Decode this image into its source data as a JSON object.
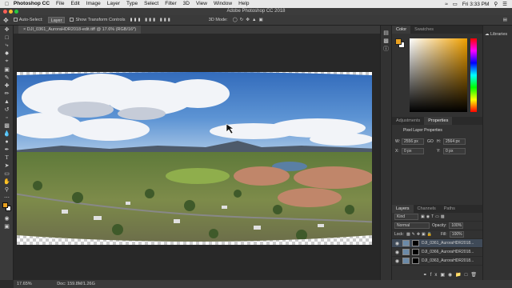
{
  "menubar": {
    "items": [
      "Photoshop CC",
      "File",
      "Edit",
      "Image",
      "Layer",
      "Type",
      "Select",
      "Filter",
      "3D",
      "View",
      "Window",
      "Help"
    ],
    "clock": "Fri 3:33 PM"
  },
  "window": {
    "title": "Adobe Photoshop CC 2018"
  },
  "options": {
    "auto_select": "Auto-Select:",
    "layer_value": "Layer",
    "transform": "Show Transform Controls",
    "mode_3d": "3D Mode:"
  },
  "document": {
    "tab": "DJI_0361_AuroraHDR2018-edit.tiff @ 17.6% (RGB/16*)"
  },
  "status": {
    "zoom": "17.65%",
    "doc": "Doc: 159.8M/1.26G"
  },
  "color_panel": {
    "tabs": [
      "Color",
      "Swatches"
    ],
    "fg": "#e8a020",
    "bg": "#ffffff"
  },
  "properties": {
    "tabs": [
      "Adjustments",
      "Properties"
    ],
    "title": "Pixel Layer Properties",
    "w_label": "W:",
    "w_value": "2556 px",
    "h_label": "H:",
    "h_value": "2564 px",
    "x_label": "X:",
    "x_value": "0 px",
    "y_label": "Y:",
    "y_value": "0 px",
    "go": "GO"
  },
  "layers": {
    "tabs": [
      "Layers",
      "Channels",
      "Paths"
    ],
    "kind": "Kind",
    "blend": "Normal",
    "opacity_label": "Opacity:",
    "opacity": "100%",
    "lock_label": "Lock:",
    "fill_label": "Fill:",
    "fill": "100%",
    "rows": [
      "DJI_0361_AuroraHDR2018...",
      "DJI_0366_AuroraHDR2018...",
      "DJI_0363_AuroraHDR2018..."
    ]
  },
  "libraries": {
    "label": "Libraries"
  }
}
